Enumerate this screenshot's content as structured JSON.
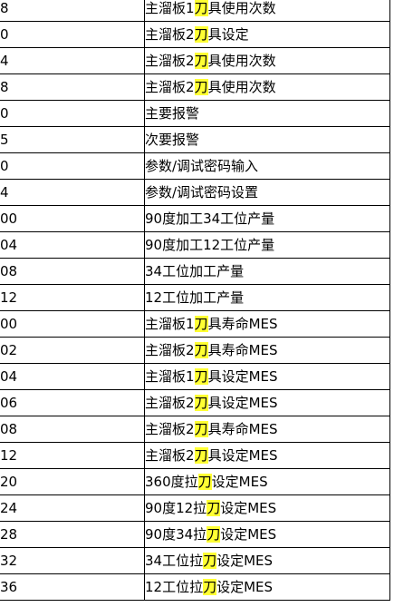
{
  "table": {
    "rows": [
      {
        "code": "8",
        "parts": [
          "主溜板1",
          "刀",
          "具使用次数"
        ]
      },
      {
        "code": "0",
        "parts": [
          "主溜板2",
          "刀",
          "具设定"
        ]
      },
      {
        "code": "4",
        "parts": [
          "主溜板2",
          "刀",
          "具使用次数"
        ]
      },
      {
        "code": "8",
        "parts": [
          "主溜板2",
          "刀",
          "具使用次数"
        ]
      },
      {
        "code": "0",
        "parts": [
          "主要报警",
          "",
          ""
        ]
      },
      {
        "code": "5",
        "parts": [
          "次要报警",
          "",
          ""
        ]
      },
      {
        "code": "0",
        "parts": [
          "参数/调试密码输入",
          "",
          ""
        ]
      },
      {
        "code": "4",
        "parts": [
          "参数/调试密码设置",
          "",
          ""
        ]
      },
      {
        "code": "00",
        "parts": [
          "90度加工34工位产量",
          "",
          ""
        ]
      },
      {
        "code": "04",
        "parts": [
          "90度加工12工位产量",
          "",
          ""
        ]
      },
      {
        "code": "08",
        "parts": [
          "34工位加工产量",
          "",
          ""
        ]
      },
      {
        "code": "12",
        "parts": [
          "12工位加工产量",
          "",
          ""
        ]
      },
      {
        "code": "00",
        "parts": [
          "主溜板1",
          "刀",
          "具寿命MES"
        ]
      },
      {
        "code": "02",
        "parts": [
          "主溜板2",
          "刀",
          "具寿命MES"
        ]
      },
      {
        "code": "04",
        "parts": [
          "主溜板1",
          "刀",
          "具设定MES"
        ]
      },
      {
        "code": "06",
        "parts": [
          "主溜板2",
          "刀",
          "具设定MES"
        ]
      },
      {
        "code": "08",
        "parts": [
          "主溜板2",
          "刀",
          "具寿命MES"
        ]
      },
      {
        "code": "12",
        "parts": [
          "主溜板2",
          "刀",
          "具设定MES"
        ]
      },
      {
        "code": "20",
        "parts": [
          "360度拉",
          "刀",
          "设定MES"
        ]
      },
      {
        "code": "24",
        "parts": [
          "90度12拉",
          "刀",
          "设定MES"
        ]
      },
      {
        "code": "28",
        "parts": [
          "90度34拉",
          "刀",
          "设定MES"
        ]
      },
      {
        "code": "32",
        "parts": [
          "34工位拉",
          "刀",
          "设定MES"
        ]
      },
      {
        "code": "36",
        "parts": [
          "12工位拉",
          "刀",
          "设定MES"
        ]
      }
    ],
    "highlight_color": "#ffff33"
  }
}
